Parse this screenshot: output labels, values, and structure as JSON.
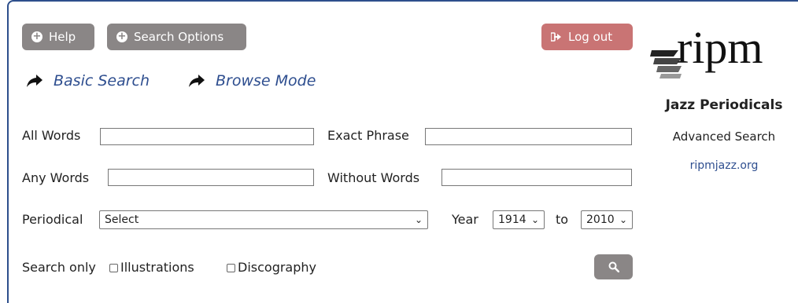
{
  "toolbar": {
    "help_label": "Help",
    "search_options_label": "Search Options",
    "logout_label": "Log out"
  },
  "nav": {
    "basic_search": "Basic Search",
    "browse_mode": "Browse Mode"
  },
  "form": {
    "all_words": {
      "label": "All Words",
      "value": ""
    },
    "exact_phrase": {
      "label": "Exact Phrase",
      "value": ""
    },
    "any_words": {
      "label": "Any Words",
      "value": ""
    },
    "without_words": {
      "label": "Without Words",
      "value": ""
    },
    "periodical": {
      "label": "Periodical",
      "selected": "Select"
    },
    "year": {
      "label": "Year",
      "from": "1914",
      "to_label": "to",
      "to": "2010"
    },
    "search_only": {
      "label": "Search only",
      "illustrations": "Illustrations",
      "discography": "Discography"
    }
  },
  "brand": {
    "logo_text": "ripm",
    "collection_title": "Jazz Periodicals",
    "mode": "Advanced Search",
    "site_link": "ripmjazz.org"
  },
  "colors": {
    "accent_blue": "#2e4e8f",
    "grey_button": "#8a8686",
    "logout_button": "#c97474"
  },
  "icons": {
    "help": "plus-circle-icon",
    "search_options": "plus-circle-icon",
    "logout": "sign-out-icon",
    "nav": "share-arrow-icon",
    "search": "magnifier-icon"
  }
}
